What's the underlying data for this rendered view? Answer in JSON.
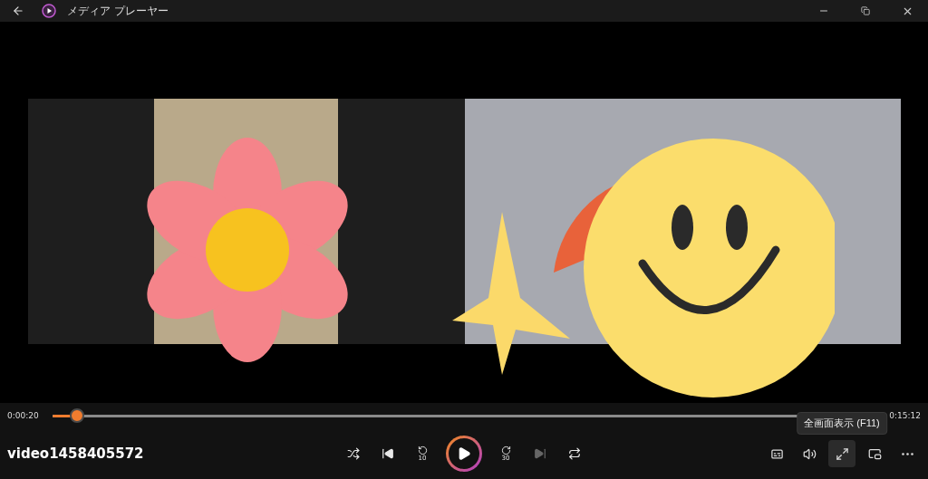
{
  "window": {
    "title": "メディア プレーヤー"
  },
  "player": {
    "elapsed": "0:00:20",
    "total": "0:15:12",
    "level": 0.03,
    "file_name": "video1458405572"
  },
  "controls": [
    {
      "kind": "shuffle",
      "disabled": false
    },
    {
      "kind": "previous",
      "disabled": false
    },
    {
      "kind": "back",
      "label": "10",
      "disabled": false
    },
    {
      "kind": "play",
      "disabled": false
    },
    {
      "kind": "forward",
      "label": "30",
      "disabled": false
    },
    {
      "kind": "next",
      "disabled": true
    },
    {
      "kind": "repeat",
      "disabled": false
    }
  ],
  "side_controls": [
    {
      "kind": "captions",
      "hovered": false
    },
    {
      "kind": "volume",
      "hovered": false
    },
    {
      "kind": "fullscreen",
      "hovered": true,
      "tooltip": "全画面表示 (F11)"
    },
    {
      "kind": "miniplayer",
      "hovered": false
    },
    {
      "kind": "more",
      "hovered": false
    }
  ]
}
